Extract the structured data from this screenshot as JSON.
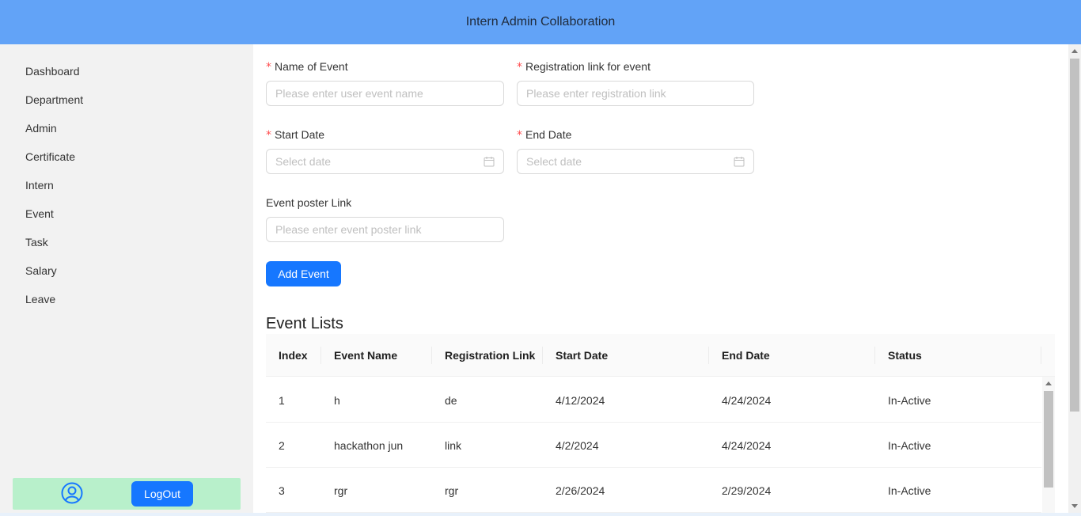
{
  "header": {
    "title": "Intern Admin Collaboration"
  },
  "sidebar": {
    "items": [
      {
        "label": "Dashboard"
      },
      {
        "label": "Department"
      },
      {
        "label": "Admin"
      },
      {
        "label": "Certificate"
      },
      {
        "label": "Intern"
      },
      {
        "label": "Event"
      },
      {
        "label": "Task"
      },
      {
        "label": "Salary"
      },
      {
        "label": "Leave"
      }
    ],
    "footer": {
      "avatar_icon": "user-circle-icon",
      "logout_label": "LogOut"
    }
  },
  "form": {
    "required_mark": "*",
    "event_name": {
      "label": "Name of Event",
      "placeholder": "Please enter user event name"
    },
    "registration_link": {
      "label": "Registration link for event",
      "placeholder": "Please enter registration link"
    },
    "start_date": {
      "label": "Start Date",
      "placeholder": "Select date",
      "icon": "calendar-icon"
    },
    "end_date": {
      "label": "End Date",
      "placeholder": "Select date",
      "icon": "calendar-icon"
    },
    "poster_link": {
      "label": "Event poster Link",
      "placeholder": "Please enter event poster link"
    },
    "submit_label": "Add Event"
  },
  "event_list": {
    "title": "Event Lists",
    "columns": [
      "Index",
      "Event Name",
      "Registration Link",
      "Start Date",
      "End Date",
      "Status"
    ],
    "rows": [
      [
        "1",
        "h",
        "de",
        "4/12/2024",
        "4/24/2024",
        "In-Active"
      ],
      [
        "2",
        "hackathon jun",
        "link",
        "4/2/2024",
        "4/24/2024",
        "In-Active"
      ],
      [
        "3",
        "rgr",
        "rgr",
        "2/26/2024",
        "2/29/2024",
        "In-Active"
      ]
    ]
  },
  "colors": {
    "header_bg": "#62a3f7",
    "primary_button": "#1677ff",
    "sidebar_bg": "#f2f2f2",
    "footer_bg": "#b8f0cb",
    "required": "#ff4d4f"
  }
}
